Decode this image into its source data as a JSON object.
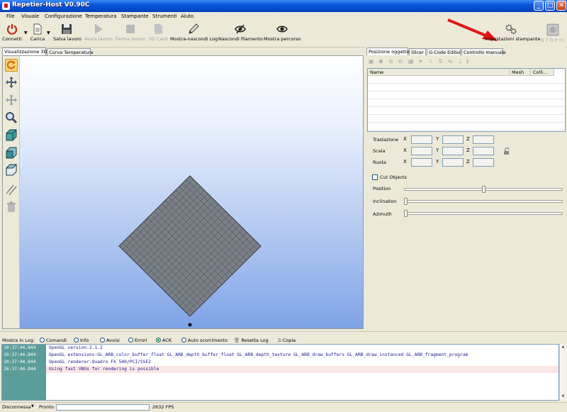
{
  "window": {
    "title": "Repetier-Host V0.90C"
  },
  "menu": [
    "File",
    "Visuale",
    "Configurazione",
    "Temperatura",
    "Stampante",
    "Strumenti",
    "Aiuto"
  ],
  "toolbar": {
    "connect": "Connetti",
    "load": "Carica",
    "save_job": "Salva lavoro",
    "start_job": "Avvia lavoro",
    "stop_job": "Ferma lavoro",
    "sd_card": "SD Card",
    "toggle_log": "Mostra-nascondi Log",
    "hide_filament": "Nascondi filamento",
    "show_path": "Mostra percorso",
    "printer_settings": "Impostazioni stampante",
    "stop": "S T O P !!!"
  },
  "left_tabs": [
    "Visualizzazione 3D",
    "Curva Temperatura"
  ],
  "right_tabs": [
    "Posizione oggetto",
    "Slicer",
    "G-Code Editor",
    "Controllo manuale"
  ],
  "object_table": {
    "columns": [
      "Name",
      "Mesh",
      "Colli..."
    ]
  },
  "transform": {
    "translate": "Traslazione",
    "scale": "Scala",
    "rotate": "Ruota",
    "x": "X",
    "y": "Y",
    "z": "Z"
  },
  "cut": {
    "cut_objects": "Cut Objects",
    "position": "Position",
    "inclination": "Inclination",
    "azimuth": "Azimuth",
    "position_value": 0.5,
    "inclination_value": 0.0,
    "azimuth_value": 0.0
  },
  "log": {
    "show_label": "Mostra in Log:",
    "options": [
      "Comandi",
      "Info",
      "Avvisi",
      "Errori",
      "ACK",
      "Auto scorrimento"
    ],
    "selected": "ACK",
    "reset": "Resetta Log",
    "copy": "Copia",
    "entries": [
      {
        "time": "10:37:44.844",
        "msg": "OpenGL version:2.1.2"
      },
      {
        "time": "10:37:44.844",
        "msg": "OpenGL extensions:GL_ARB_color_buffer_float GL_ARB_depth_buffer_float GL_ARB_depth_texture GL_ARB_draw_buffers GL_ARB_draw_instanced GL_ARB_fragment_program"
      },
      {
        "time": "10:37:44.844",
        "msg": "OpenGL renderer:Quadro FX 580/PCI/SSE2"
      },
      {
        "time": "10:37:44.844",
        "msg": "Using fast VBOs for rendering is possible"
      }
    ]
  },
  "status": {
    "connection": "Disconnessa",
    "state": "Pronto",
    "fps": "2632 FPS"
  },
  "colors": {
    "title_blue": "#0a54d8",
    "log_time_bg": "#5b9e99",
    "accent_red": "#e01515"
  }
}
